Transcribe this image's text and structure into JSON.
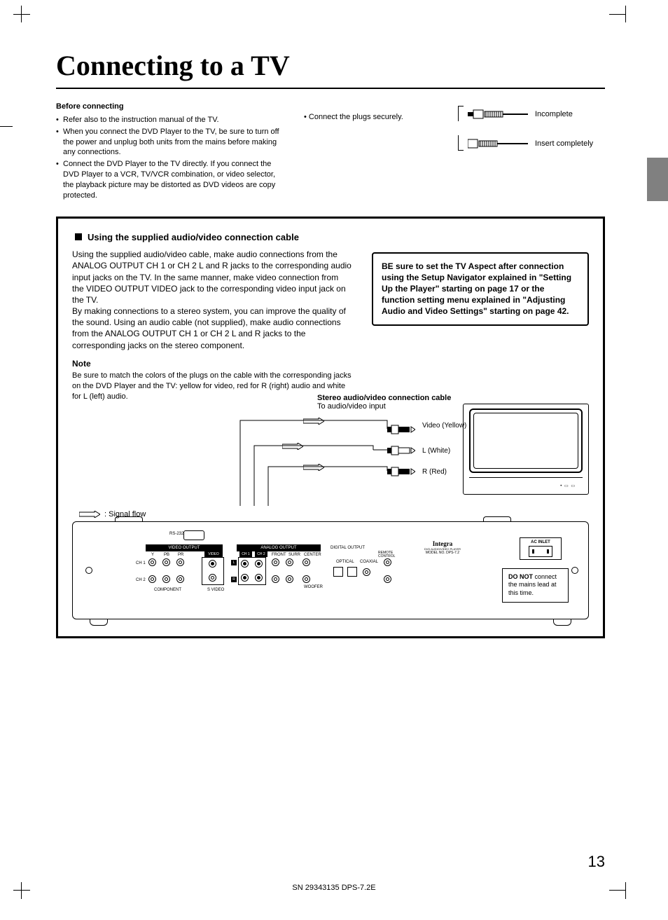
{
  "title": "Connecting to a TV",
  "before": {
    "heading": "Before connecting",
    "items": [
      "Refer also to the instruction manual of the TV.",
      "When you connect the DVD Player to the TV, be sure to turn off the power and unplug both units from the mains before making any connections.",
      "Connect the DVD Player to the TV directly. If you connect the DVD Player to a VCR, TV/VCR combination, or video selector, the playback picture may be distorted as DVD videos are copy protected."
    ]
  },
  "connect_securely": "Connect the plugs securely.",
  "plug_labels": {
    "incomplete": "Incomplete",
    "insert": "Insert completely"
  },
  "section_head": "Using the supplied audio/video connection cable",
  "body1": "Using the supplied audio/video cable, make audio connections from the ANALOG OUTPUT CH 1 or CH 2 L and R jacks to the corresponding audio input jacks on the TV. In the same manner, make video connection from the VIDEO OUTPUT VIDEO jack to the corresponding video input jack on the TV.",
  "body2": "By making connections to a stereo system, you can improve the quality of the sound. Using an audio cable (not supplied), make audio connections from the ANALOG OUTPUT CH 1 or CH 2 L and R jacks to the corresponding jacks on the stereo component.",
  "note_head": "Note",
  "note_body": "Be sure to match the colors of the plugs on the cable with the corresponding jacks on the DVD Player and the TV: yellow for video, red for R (right) audio and white for L (left) audio.",
  "warn": "BE sure to set the TV Aspect after connection using the Setup Navigator explained in \"Setting Up the Player\" starting on page 17 or the function setting menu explained in \"Adjusting Audio and Video Settings\" starting on page 42.",
  "signal_flow": ": Signal flow",
  "cable_title": "Stereo audio/video connection cable",
  "cable_sub": "To audio/video input",
  "rca": {
    "video": "Video (Yellow)",
    "l": "L (White)",
    "r": "R (Red)"
  },
  "panel": {
    "rs232": "RS-232",
    "video_output": "VIDEO OUTPUT",
    "analog_output": "ANALOG OUTPUT",
    "digital_output": "DIGITAL OUTPUT",
    "remote": "REMOTE CONTROL",
    "video": "VIDEO",
    "ch1": "CH 1",
    "ch2": "CH 2",
    "front": "FRONT",
    "surr": "SURR",
    "center": "CENTER",
    "woofer": "WOOFER",
    "optical": "OPTICAL",
    "coaxial": "COAXIAL",
    "row_ch1": "CH 1",
    "row_ch2": "CH 2",
    "Y": "Y",
    "PB": "PB",
    "PR": "PR",
    "L": "L",
    "R": "R",
    "component": "COMPONENT",
    "svideo": "S VIDEO",
    "brand": "Integra",
    "brand_sub": "DVD AUDIO/VIDEO PLAYER",
    "model": "MODEL NO. DPS-7.2",
    "ac": "AC INLET"
  },
  "donot": {
    "bold": "DO NOT",
    "rest": " connect the mains lead at this time."
  },
  "page_number": "13",
  "footer": "SN 29343135 DPS-7.2E"
}
